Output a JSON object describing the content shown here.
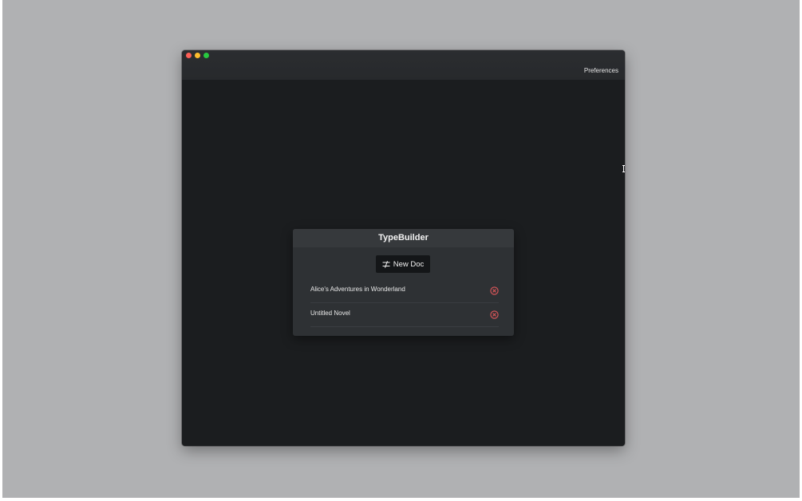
{
  "menubar": {
    "preferences_label": "Preferences"
  },
  "dialog": {
    "title": "TypeBuilder",
    "new_doc_label": "New Doc",
    "new_doc_icon": "sliders-icon",
    "documents": [
      {
        "title": "Alice's Adventures in Wonderland",
        "delete_icon": "circle-x-icon"
      },
      {
        "title": "Untitled Novel",
        "delete_icon": "circle-x-icon"
      }
    ]
  },
  "colors": {
    "desktop": "#b0b1b3",
    "window_bg": "#1b1d1f",
    "dialog_bg": "#2e3134",
    "button_bg": "#141618",
    "delete_red": "#e0575b",
    "traffic_close": "#fc5f57",
    "traffic_min": "#fdbc2e",
    "traffic_max": "#28c840"
  }
}
